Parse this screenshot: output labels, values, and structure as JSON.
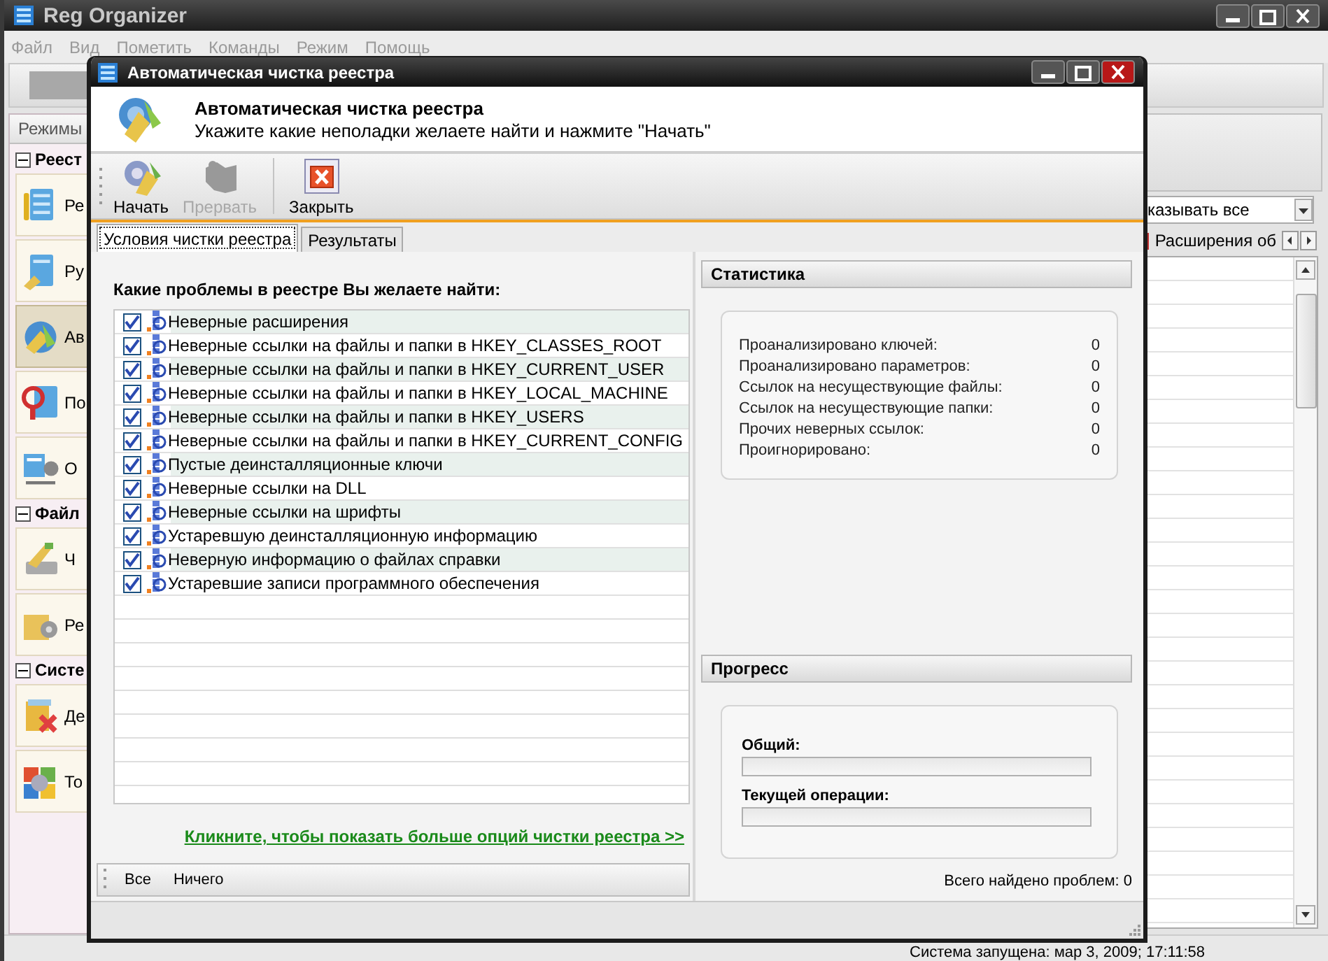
{
  "main_window": {
    "title": "Reg Organizer",
    "menu": [
      "Файл",
      "Вид",
      "Пометить",
      "Команды",
      "Режим",
      "Помощь"
    ],
    "sidebar": {
      "header": "Режимы",
      "groups": [
        {
          "label": "Реест",
          "expanded": true,
          "items": [
            {
              "label": "Ре",
              "selected": false
            },
            {
              "label": "Ру",
              "selected": false
            },
            {
              "label": "Ав",
              "selected": true
            },
            {
              "label": "По",
              "selected": false
            },
            {
              "label": "О",
              "selected": false
            }
          ]
        },
        {
          "label": "Файл",
          "expanded": true,
          "items": [
            {
              "label": "Ч",
              "selected": false
            },
            {
              "label": "Ре",
              "selected": false
            }
          ]
        },
        {
          "label": "Систе",
          "expanded": true,
          "items": [
            {
              "label": "Де",
              "selected": false
            },
            {
              "label": "То",
              "selected": false
            }
          ]
        }
      ]
    },
    "filter": {
      "value": "казывать все"
    },
    "tab": {
      "label": "Расширения об"
    },
    "status_bar": "Система запущена: мар 3, 2009; 17:11:58"
  },
  "dialog": {
    "title": "Автоматическая чистка реестра",
    "header": {
      "title": "Автоматическая чистка реестра",
      "subtitle": "Укажите какие неполадки желаете найти и нажмите \"Начать\""
    },
    "toolbar": [
      {
        "label": "Начать",
        "disabled": false
      },
      {
        "label": "Прервать",
        "disabled": true
      },
      {
        "label": "Закрыть",
        "disabled": false
      }
    ],
    "tabs": [
      {
        "label": "Условия чистки реестра",
        "selected": true
      },
      {
        "label": "Результаты",
        "selected": false
      }
    ],
    "options": {
      "heading": "Какие проблемы в реестре Вы желаете найти:",
      "items": [
        {
          "label": "Неверные расширения",
          "checked": true
        },
        {
          "label": "Неверные ссылки на файлы и папки в HKEY_CLASSES_ROOT",
          "checked": true
        },
        {
          "label": "Неверные ссылки на файлы и папки в HKEY_CURRENT_USER",
          "checked": true
        },
        {
          "label": "Неверные ссылки на файлы и папки в HKEY_LOCAL_MACHINE",
          "checked": true
        },
        {
          "label": "Неверные ссылки на файлы и папки в HKEY_USERS",
          "checked": true
        },
        {
          "label": "Неверные ссылки на файлы и папки в HKEY_CURRENT_CONFIG",
          "checked": true
        },
        {
          "label": "Пустые деинсталляционные ключи",
          "checked": true
        },
        {
          "label": "Неверные ссылки на DLL",
          "checked": true
        },
        {
          "label": "Неверные ссылки на шрифты",
          "checked": true
        },
        {
          "label": "Устаревшую деинсталляционную информацию",
          "checked": true
        },
        {
          "label": "Неверную информацию о файлах справки",
          "checked": true
        },
        {
          "label": "Устаревшие записи программного обеспечения",
          "checked": true
        }
      ],
      "more_link": "Кликните, чтобы показать больше опций чистки реестра >>",
      "select_buttons": [
        "Все",
        "Ничего"
      ]
    },
    "statistics": {
      "title": "Статистика",
      "rows": [
        {
          "label": "Проанализировано ключей:",
          "value": "0"
        },
        {
          "label": "Проанализировано параметров:",
          "value": "0"
        },
        {
          "label": "Ссылок на несуществующие файлы:",
          "value": "0"
        },
        {
          "label": "Ссылок на несуществующие папки:",
          "value": "0"
        },
        {
          "label": "Прочих неверных ссылок:",
          "value": "0"
        },
        {
          "label": "Проигнорировано:",
          "value": "0"
        }
      ]
    },
    "progress": {
      "title": "Прогресс",
      "bars": [
        {
          "label": "Общий:",
          "level": 0
        },
        {
          "label": "Текущей операции:",
          "level": 0
        }
      ]
    },
    "total": "Всего найдено проблем: 0"
  }
}
